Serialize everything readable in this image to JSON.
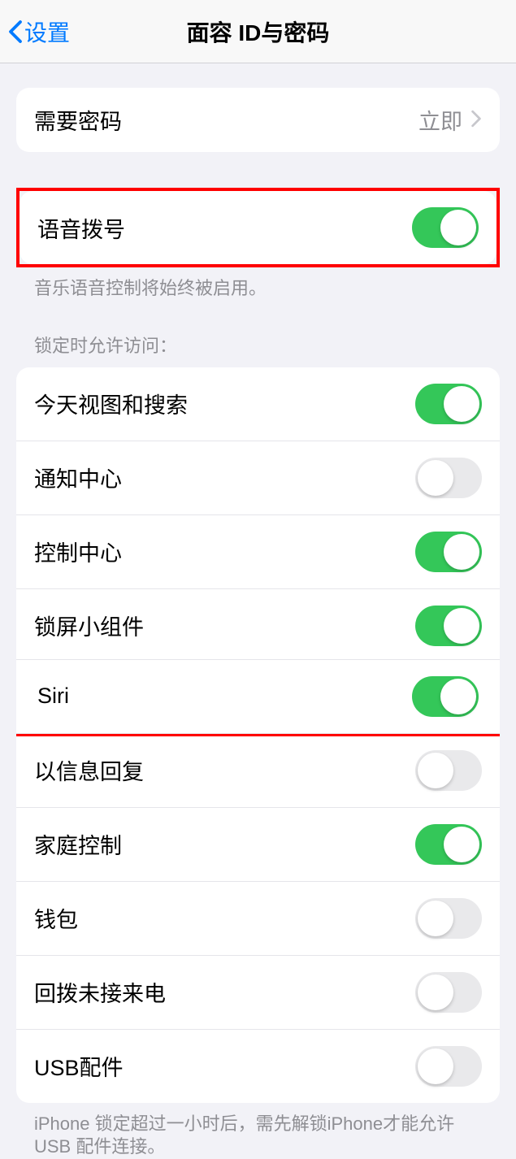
{
  "header": {
    "back_label": "设置",
    "title": "面容 ID与密码"
  },
  "require_passcode": {
    "label": "需要密码",
    "value": "立即"
  },
  "voice_dial": {
    "label": "语音拨号",
    "on": true,
    "footer": "音乐语音控制将始终被启用。"
  },
  "lock_access": {
    "header": "锁定时允许访问：",
    "items": [
      {
        "label": "今天视图和搜索",
        "on": true
      },
      {
        "label": "通知中心",
        "on": false
      },
      {
        "label": "控制中心",
        "on": true
      },
      {
        "label": "锁屏小组件",
        "on": true
      },
      {
        "label": "Siri",
        "on": true
      },
      {
        "label": "以信息回复",
        "on": false
      },
      {
        "label": "家庭控制",
        "on": true
      },
      {
        "label": "钱包",
        "on": false
      },
      {
        "label": "回拨未接来电",
        "on": false
      },
      {
        "label": "USB配件",
        "on": false
      }
    ],
    "footer": "iPhone 锁定超过一小时后，需先解锁iPhone才能允许USB 配件连接。"
  }
}
